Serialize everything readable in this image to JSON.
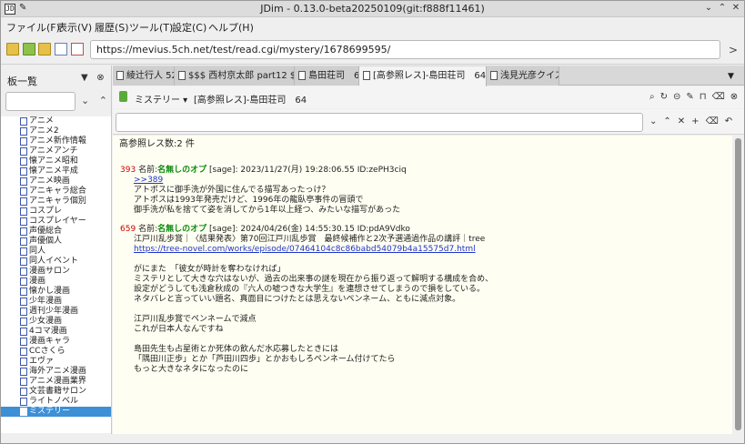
{
  "window": {
    "title": "JDim - 0.13.0-beta20250109(git:f888f11461)",
    "app_icon": "JD"
  },
  "menu": [
    "ファイル(F)",
    "表示(V)",
    "履歴(S)",
    "ツール(T)",
    "設定(C)",
    "ヘルプ(H)"
  ],
  "toolbar": {
    "url": "https://mevius.5ch.net/test/read.cgi/mystery/1678699595/"
  },
  "left_pane": {
    "header": "板一覧",
    "boards": [
      "アニメ",
      "アニメ2",
      "アニメ新作情報",
      "アニメアンチ",
      "懐アニメ昭和",
      "懐アニメ平成",
      "アニメ映画",
      "アニキャラ総合",
      "アニキャラ個別",
      "コスプレ",
      "コスプレイヤー",
      "声優総合",
      "声優個人",
      "同人",
      "同人イベント",
      "漫画サロン",
      "漫画",
      "懐かし漫画",
      "少年漫画",
      "週刊少年漫画",
      "少女漫画",
      "4コマ漫画",
      "漫画キャラ",
      "CCさくら",
      "エヴァ",
      "海外アニメ漫画",
      "アニメ漫画業界",
      "文芸書籍サロン",
      "ライトノベル",
      "ミステリー"
    ],
    "selected": "ミステリー"
  },
  "tabs": [
    {
      "label": "綾辻行人 52"
    },
    {
      "label": "$$$ 西村京太郎 part12 $$$"
    },
    {
      "label": "島田荘司　64"
    },
    {
      "label": "[高参照レス]-島田荘司　64"
    },
    {
      "label": "浅見光彦クイズ"
    }
  ],
  "thread": {
    "category": "ミステリー ▾",
    "title": "[高参照レス]-島田荘司　64"
  },
  "content": {
    "summary": "高参照レス数:2 件",
    "posts": [
      {
        "num": "393",
        "name_label": "名前:",
        "name": "名無しのオプ",
        "meta": "[sage]: 2023/11/27(月) 19:28:06.55 ID:zePH3ciq",
        "anchor": ">>389",
        "body": [
          "アトポスに御手洗が外国に住んでる描写あったっけ？",
          "アトポスは1993年発売だけど、1996年の龍臥亭事件の冒頭で",
          "御手洗が私を捨てて姿を消してから1年以上経つ、みたいな描写があった"
        ]
      },
      {
        "num": "659",
        "name_label": "名前:",
        "name": "名無しのオプ",
        "meta": "[sage]: 2024/04/26(金) 14:55:30.15 ID:pdA9Vdko",
        "body_top": "江戸川乱歩賞｜〈結果発表〉第70回江戸川乱歩賞　最終候補作と2次予選通過作品の講評｜tree",
        "link": "https://tree-novel.com/works/episode/07464104c8c86babd54079b4a15575d7.html",
        "body": [
          "がにまた　「彼女が時計を奪わなければ」",
          "ミステリとして大きな穴はないが、過去の出来事の謎を現在から振り返って解明する構成を合め、",
          "設定がどうしても浅倉秋成の『六人の嘘つきな大学生』を連想させてしまうので損をしている。",
          "ネタバレと言っていい題名、真面目につけたとは思えないペンネーム、ともに減点対象。",
          "",
          "江戸川乱歩賞でペンネームで減点",
          "これが日本人なんですね",
          "",
          "島田先生も占星術とか死体の飲んだ水応募したときには",
          "「隅田川正歩」とか「芦田川四歩」とかおもしろペンネーム付けてたら",
          "もっと大きなネタになったのに"
        ]
      }
    ]
  }
}
